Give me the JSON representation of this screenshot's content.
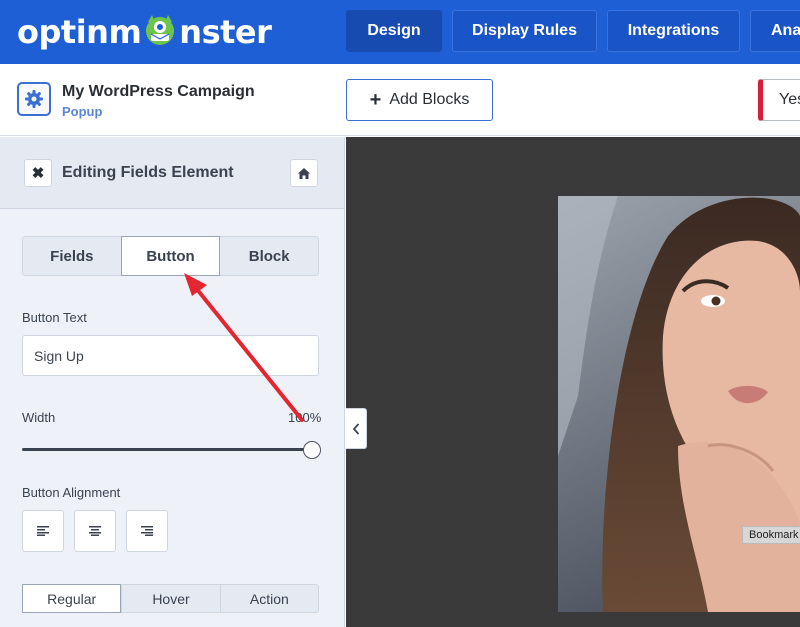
{
  "header": {
    "logo_text_a": "optinm",
    "logo_text_b": "nster",
    "tabs": [
      {
        "label": "Design",
        "active": true
      },
      {
        "label": "Display Rules",
        "active": false
      },
      {
        "label": "Integrations",
        "active": false
      },
      {
        "label": "Ana",
        "active": false
      }
    ]
  },
  "campaign": {
    "title": "My WordPress Campaign",
    "type": "Popup",
    "add_blocks_label": "Add Blocks",
    "yes_label": "Yes"
  },
  "panel": {
    "title": "Editing Fields Element",
    "tabs": [
      {
        "label": "Fields",
        "active": false
      },
      {
        "label": "Button",
        "active": true
      },
      {
        "label": "Block",
        "active": false
      }
    ],
    "button_text_label": "Button Text",
    "button_text_value": "Sign Up",
    "width_label": "Width",
    "width_value": "100%",
    "width_fraction": 1.0,
    "alignment_label": "Button Alignment",
    "alignment_options": [
      "left",
      "center",
      "right"
    ],
    "state_tabs": [
      {
        "label": "Regular",
        "active": true
      },
      {
        "label": "Hover",
        "active": false
      },
      {
        "label": "Action",
        "active": false
      }
    ]
  },
  "preview": {
    "bookmark_label": "Bookmark"
  },
  "colors": {
    "brand_blue": "#1e5fd6",
    "annotation_arrow": "#e3262f",
    "accent_red": "#d6203a"
  }
}
